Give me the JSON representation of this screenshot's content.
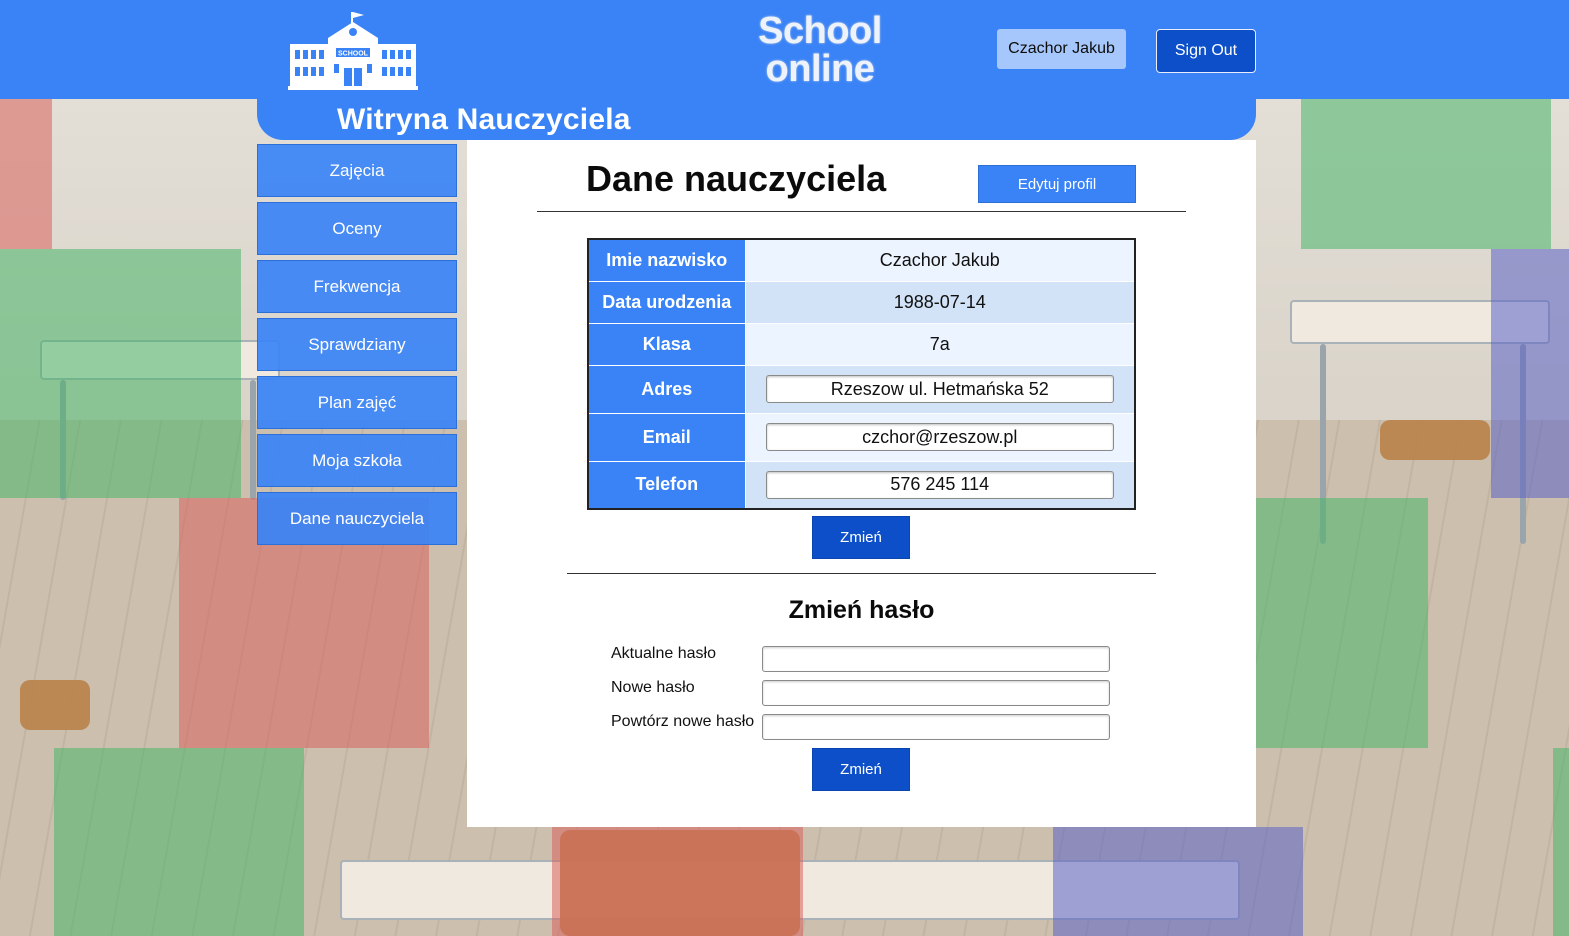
{
  "header": {
    "brand_line1": "School",
    "brand_line2": "online",
    "logo_sign": "SCHOOL",
    "user_name": "Czachor Jakub",
    "signout_label": "Sign Out"
  },
  "band": {
    "title": "Witryna Nauczyciela"
  },
  "sidebar": {
    "items": [
      {
        "label": "Zajęcia"
      },
      {
        "label": "Oceny"
      },
      {
        "label": "Frekwencja"
      },
      {
        "label": "Sprawdziany"
      },
      {
        "label": "Plan zajęć"
      },
      {
        "label": "Moja szkoła"
      },
      {
        "label": "Dane nauczyciela"
      }
    ]
  },
  "main": {
    "title": "Dane nauczyciela",
    "edit_label": "Edytuj profil",
    "profile": {
      "name_label": "Imie nazwisko",
      "name_value": "Czachor Jakub",
      "dob_label": "Data urodzenia",
      "dob_value": "1988-07-14",
      "class_label": "Klasa",
      "class_value": "7a",
      "address_label": "Adres",
      "address_value": "Rzeszow ul. Hetmańska 52",
      "email_label": "Email",
      "email_value": "czchor@rzeszow.pl",
      "phone_label": "Telefon",
      "phone_value": "576 245 114"
    },
    "save_profile_label": "Zmień",
    "password": {
      "title": "Zmień hasło",
      "current_label": "Aktualne hasło",
      "new_label": "Nowe hasło",
      "repeat_label": "Powtórz nowe hasło",
      "submit_label": "Zmień"
    }
  },
  "colors": {
    "primary": "#3a83f6",
    "primary_dark": "#0c4fc8",
    "user_badge": "#a6c7fb"
  }
}
